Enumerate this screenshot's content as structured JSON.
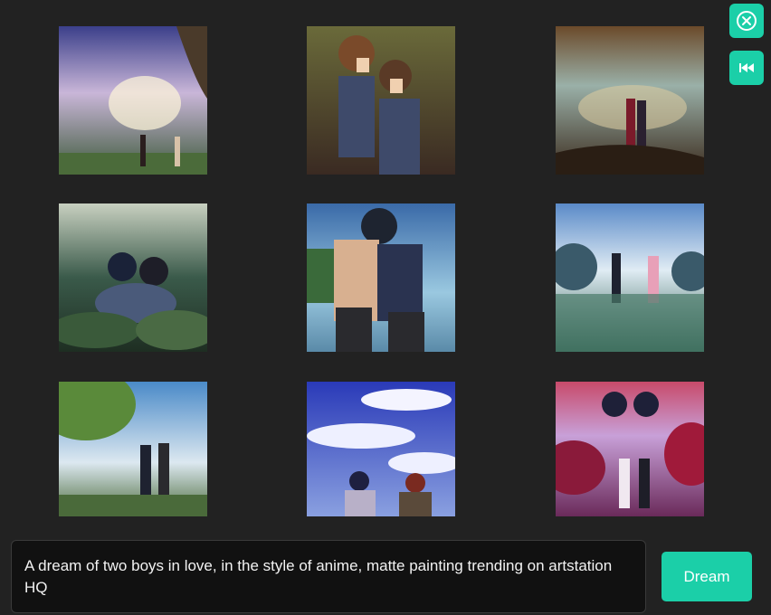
{
  "gallery": {
    "images": [
      {
        "subject": "two boys standing in sunlit forest clearing"
      },
      {
        "subject": "two anime boys leaning together in forest"
      },
      {
        "subject": "two boys embracing under dramatic clouds"
      },
      {
        "subject": "two boys hugging among green foliage"
      },
      {
        "subject": "shirtless boys embracing by blue sky"
      },
      {
        "subject": "two boys pointing at sky on wet field"
      },
      {
        "subject": "two boys under tree with blue sky"
      },
      {
        "subject": "two boys looking at bright cloudy sky"
      },
      {
        "subject": "two boys in pink and purple dreamscape"
      }
    ]
  },
  "controls": {
    "close_icon": "close-circle-icon",
    "rewind_icon": "skip-back-icon",
    "accent_color": "#1bcfa8"
  },
  "prompt": {
    "text": "A dream of two boys in love, in the style of anime, matte painting trending on artstation HQ"
  },
  "dream_button": {
    "label": "Dream"
  }
}
